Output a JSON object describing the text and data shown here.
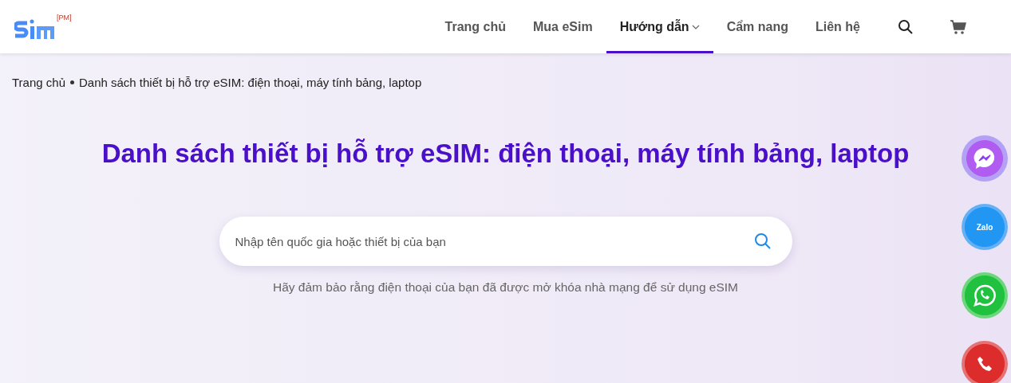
{
  "header": {
    "logo_badge": "[PM]",
    "nav": [
      {
        "label": "Trang chủ",
        "selected": false,
        "dropdown": false
      },
      {
        "label": "Mua eSim",
        "selected": false,
        "dropdown": false
      },
      {
        "label": "Hướng dẫn",
        "selected": true,
        "dropdown": true
      },
      {
        "label": "Cẩm nang",
        "selected": false,
        "dropdown": false
      },
      {
        "label": "Liên hệ",
        "selected": false,
        "dropdown": false
      }
    ]
  },
  "breadcrumb": [
    {
      "label": "Trang chủ"
    },
    {
      "label": "Danh sách thiết bị hỗ trợ eSIM: điện thoại, máy tính bảng, laptop"
    }
  ],
  "title": "Danh sách thiết bị hỗ trợ eSIM: điện thoại, máy tính bảng, laptop",
  "search": {
    "placeholder": "Nhập tên quốc gia hoặc thiết bị của bạn"
  },
  "note": "Hãy đảm bảo rằng điện thoại của bạn đã được mở khóa nhà mạng để sử dụng eSIM",
  "contact_buttons": [
    {
      "kind": "messenger"
    },
    {
      "kind": "zalo",
      "label": "Zalo"
    },
    {
      "kind": "whatsapp"
    },
    {
      "kind": "phone"
    }
  ]
}
